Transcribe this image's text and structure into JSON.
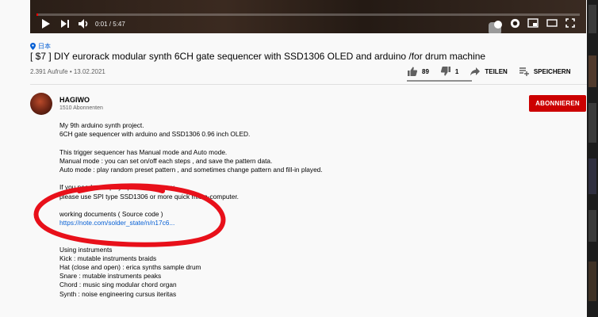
{
  "player": {
    "time": "0:01 / 5:47",
    "progress_fraction": 0.003,
    "icons": [
      "play-icon",
      "next-icon",
      "volume-icon",
      "autoplay-toggle",
      "settings-icon",
      "miniplayer-icon",
      "theater-icon",
      "fullscreen-icon"
    ]
  },
  "video": {
    "location": "日本",
    "title": "[ $7 ] DIY eurorack modular synth 6CH gate sequencer with SSD1306 OLED and arduino /for drum machine",
    "meta": "2.391 Aufrufe • 13.02.2021"
  },
  "actions": {
    "likes": "89",
    "dislikes": "1",
    "share": "TEILEN",
    "save": "SPEICHERN"
  },
  "channel": {
    "name": "HAGIWO",
    "subscribers": "1510 Abonnenten",
    "subscribe_label": "ABONNIEREN"
  },
  "description": {
    "lines": [
      "My 9th arduino synth project.",
      "6CH gate sequencer with arduino and SSD1306 0.96 inch OLED.",
      "",
      "This trigger sequencer has Manual mode and Auto mode.",
      "Manual mode : you can set on/off each steps , and save the pattern data.",
      "Auto mode : play random preset pattern , and sometimes change pattern and fill-in played.",
      "",
      "If you need ... display update frequency,",
      "please use SPI type SSD1306 or more quick micro-computer.",
      "",
      "working documents ( Source code )",
      "https://note.com/solder_state/n/n17c6...",
      "",
      "",
      "Using instruments",
      "Kick : mutable instruments braids",
      "Hat (close and open) : erica synths sample drum",
      "Snare : mutable instruments peaks",
      "Chord : music sing modular chord organ",
      "Synth : noise engineering cursus iteritas"
    ]
  },
  "colors": {
    "subscribe": "#cc0000",
    "link": "#065fd4",
    "annotation": "#e8101a"
  }
}
